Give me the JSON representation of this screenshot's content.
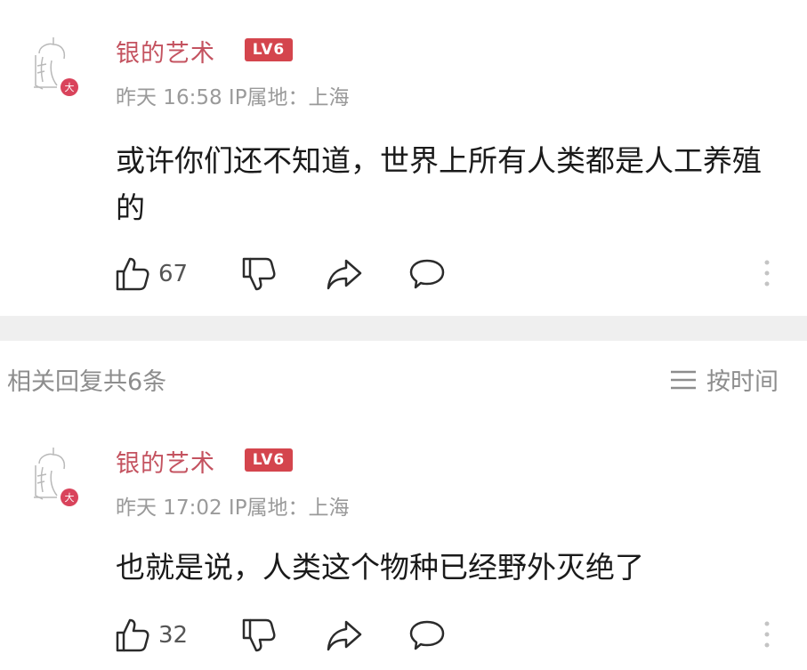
{
  "main_comment": {
    "username": "银的艺术",
    "level_badge": "LV6",
    "time": "昨天 16:58",
    "ip_location": "IP属地：上海",
    "text": "或许你们还不知道，世界上所有人类都是人工养殖的",
    "likes": "67"
  },
  "replies_header": {
    "count_label": "相关回复共6条",
    "sort_label": "按时间"
  },
  "reply": {
    "username": "银的艺术",
    "level_badge": "LV6",
    "time": "昨天 17:02",
    "ip_location": "IP属地：上海",
    "text": "也就是说，人类这个物种已经野外灭绝了",
    "likes": "32"
  },
  "icons": {
    "like": "thumb-up-icon",
    "dislike": "thumb-down-icon",
    "share": "share-icon",
    "reply": "comment-icon",
    "more": "more-vertical-icon",
    "sort": "menu-lines-icon"
  },
  "colors": {
    "username": "#c45360",
    "badge": "#d4454d",
    "meta": "#9a9a9a",
    "divider": "#efefef"
  }
}
